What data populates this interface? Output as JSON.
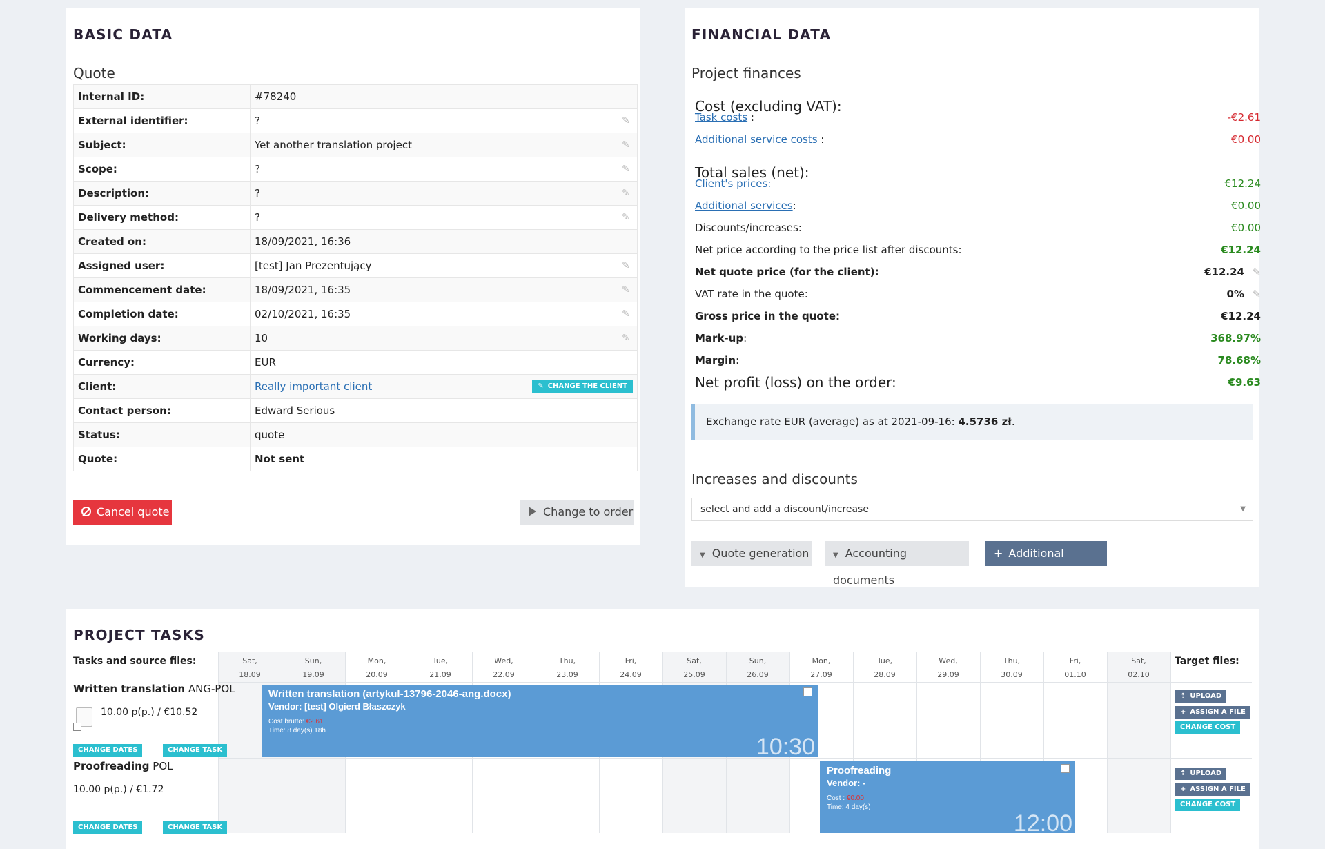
{
  "basic": {
    "title": "BASIC DATA",
    "section": "Quote",
    "rows": [
      {
        "label": "Internal ID:",
        "value": "#78240"
      },
      {
        "label": "External identifier:",
        "value": "?"
      },
      {
        "label": "Subject:",
        "value": "Yet another translation project"
      },
      {
        "label": "Scope:",
        "value": "?"
      },
      {
        "label": "Description:",
        "value": "?"
      },
      {
        "label": "Delivery method:",
        "value": "?"
      },
      {
        "label": "Created on:",
        "value": "18/09/2021, 16:36"
      },
      {
        "label": "Assigned user:",
        "value": "[test] Jan Prezentujący"
      },
      {
        "label": "Commencement date:",
        "value": "18/09/2021, 16:35"
      },
      {
        "label": "Completion date:",
        "value": "02/10/2021, 16:35"
      },
      {
        "label": "Working days:",
        "value": "10"
      },
      {
        "label": "Currency:",
        "value": "EUR"
      },
      {
        "label": "Client:",
        "value": "Really important client"
      },
      {
        "label": "Contact person:",
        "value": "Edward Serious"
      },
      {
        "label": "Status:",
        "value": "quote"
      },
      {
        "label": "Quote:",
        "value": "Not sent"
      }
    ],
    "change_client": "CHANGE THE CLIENT",
    "cancel_quote": "Cancel quote",
    "change_to_order": "Change to order"
  },
  "financial": {
    "title": "FINANCIAL DATA",
    "section": "Project finances",
    "cost_head": "Cost (excluding VAT):",
    "task_costs_label": "Task costs",
    "task_costs": "-€2.61",
    "add_service_costs_label": "Additional service costs",
    "add_service_costs": "€0.00",
    "sales_head": "Total sales (net):",
    "clients_prices_label": "Client's prices:",
    "clients_prices": "€12.24",
    "additional_services_label": "Additional services",
    "additional_services": "€0.00",
    "discounts_label": "Discounts/increases:",
    "discounts": "€0.00",
    "net_after_disc_label": "Net price according to the price list after discounts:",
    "net_after_disc": "€12.24",
    "net_quote_label": "Net quote price (for the client):",
    "net_quote": "€12.24",
    "vat_label": "VAT rate in the quote:",
    "vat": "0%",
    "gross_label": "Gross price in the quote:",
    "gross": "€12.24",
    "markup_label": "Mark-up",
    "markup": "368.97%",
    "margin_label": "Margin",
    "margin": "78.68%",
    "profit_label": "Net profit (loss) on the order:",
    "profit": "€9.63",
    "exchange_text": "Exchange rate EUR (average) as at 2021-09-16: ",
    "exchange_value": "4.5736 zł",
    "increases_title": "Increases and discounts",
    "select_placeholder": "select and add a discount/increase",
    "btn_quote_gen": "Quote generation",
    "btn_accounting": "Accounting documents",
    "btn_add_service": "Additional service"
  },
  "tasks": {
    "title": "PROJECT TASKS",
    "tasks_col_label": "Tasks and source files:",
    "target_col_label": "Target files:",
    "days": [
      {
        "d": "Sat,",
        "n": "18.09"
      },
      {
        "d": "Sun,",
        "n": "19.09"
      },
      {
        "d": "Mon,",
        "n": "20.09"
      },
      {
        "d": "Tue,",
        "n": "21.09"
      },
      {
        "d": "Wed,",
        "n": "22.09"
      },
      {
        "d": "Thu,",
        "n": "23.09"
      },
      {
        "d": "Fri,",
        "n": "24.09"
      },
      {
        "d": "Sat,",
        "n": "25.09"
      },
      {
        "d": "Sun,",
        "n": "26.09"
      },
      {
        "d": "Mon,",
        "n": "27.09"
      },
      {
        "d": "Tue,",
        "n": "28.09"
      },
      {
        "d": "Wed,",
        "n": "29.09"
      },
      {
        "d": "Thu,",
        "n": "30.09"
      },
      {
        "d": "Fri,",
        "n": "01.10"
      },
      {
        "d": "Sat,",
        "n": "02.10"
      }
    ],
    "task1": {
      "name_bold": "Written translation",
      "name_lang": " ANG-POL",
      "price": "10.00 p(p.) /  €10.52",
      "bar_title": "Written translation (artykul-13796-2046-ang.docx)",
      "vendor": "Vendor: [test] Olgierd Błaszczyk",
      "cost_label": "Cost brutto: ",
      "cost": "€2.61",
      "time": "Time: 8 day(s) 18h",
      "clock": "10:30"
    },
    "task2": {
      "name_bold": "Proofreading",
      "name_lang": " POL",
      "price": "10.00 p(p.) /  €1.72",
      "bar_title": "Proofreading",
      "vendor": "Vendor: -",
      "cost_label": "Cost : ",
      "cost": "€0.00",
      "time": "Time: 4 day(s)",
      "clock": "12:00"
    },
    "change_dates": "CHANGE DATES",
    "change_task": "CHANGE TASK",
    "upload": "UPLOAD",
    "assign_file": "ASSIGN A FILE",
    "change_cost": "CHANGE COST"
  }
}
